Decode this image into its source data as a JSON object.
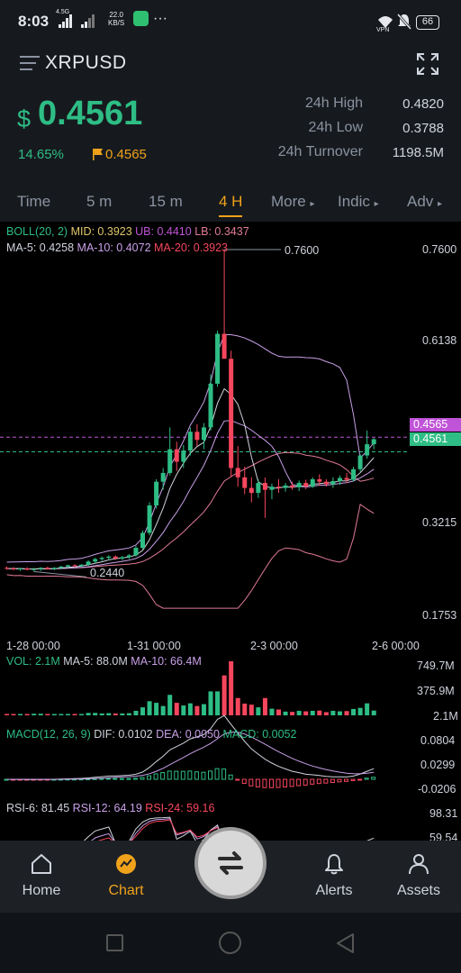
{
  "status_bar": {
    "time": "8:03",
    "network": "4.5G",
    "speed_value": "22.0",
    "speed_unit": "KB/S",
    "more": "···",
    "vpn": "VPN",
    "battery": "66"
  },
  "header": {
    "symbol": "XRPUSD",
    "menu_icon": "menu-icon",
    "fullscreen_icon": "fullscreen-icon"
  },
  "ticker": {
    "currency": "$",
    "price": "0.4561",
    "change_pct": "14.65%",
    "flag_price": "0.4565",
    "stats": [
      {
        "label": "24h High",
        "value": "0.4820"
      },
      {
        "label": "24h Low",
        "value": "0.3788"
      },
      {
        "label": "24h Turnover",
        "value": "1198.5M"
      }
    ]
  },
  "timeframes": [
    {
      "label": "Time",
      "active": false
    },
    {
      "label": "5 m",
      "active": false
    },
    {
      "label": "15 m",
      "active": false
    },
    {
      "label": "4 H",
      "active": true
    },
    {
      "label": "More",
      "active": false
    },
    {
      "label": "Indic",
      "active": false
    },
    {
      "label": "Adv",
      "active": false
    }
  ],
  "indicators": {
    "boll": {
      "name": "BOLL(20, 2)",
      "mid": "MID: 0.3923",
      "ub": "UB: 0.4410",
      "lb": "LB: 0.3437"
    },
    "ma": {
      "ma5": "MA-5: 0.4258",
      "ma10": "MA-10: 0.4072",
      "ma20": "MA-20: 0.3923"
    },
    "vol": {
      "vol": "VOL: 2.1M",
      "ma5": "MA-5: 88.0M",
      "ma10": "MA-10: 66.4M"
    },
    "macd": {
      "name": "MACD(12, 26, 9)",
      "dif": "DIF: 0.0102",
      "dea": "DEA: 0.0050",
      "macd": "MACD: 0.0052"
    },
    "rsi": {
      "rsi6": "RSI-6: 81.45",
      "rsi12": "RSI-12: 64.19",
      "rsi24": "RSI-24: 59.16"
    }
  },
  "chart_data": {
    "type": "candlestick",
    "price_axis": [
      "0.7600",
      "0.6138",
      "0.4565",
      "0.4561",
      "0.3215",
      "0.1753"
    ],
    "time_axis": [
      "1-28 00:00",
      "1-31 00:00",
      "2-3 00:00",
      "2-6 00:00"
    ],
    "annotations": {
      "high": "0.7600",
      "low": "0.2440"
    },
    "ylim": [
      0.1753,
      0.76
    ],
    "current_price": 0.4561,
    "flag_price": 0.4565,
    "volume_axis": [
      "749.7M",
      "375.9M",
      "2.1M"
    ],
    "macd_axis": [
      "0.0804",
      "0.0299",
      "-0.0206"
    ],
    "rsi_axis": [
      "98.31",
      "59.54"
    ],
    "candles": [
      [
        0.25,
        0.252,
        0.247,
        0.249
      ],
      [
        0.249,
        0.251,
        0.246,
        0.248
      ],
      [
        0.248,
        0.25,
        0.245,
        0.249
      ],
      [
        0.249,
        0.251,
        0.246,
        0.247
      ],
      [
        0.247,
        0.25,
        0.244,
        0.248
      ],
      [
        0.248,
        0.251,
        0.245,
        0.25
      ],
      [
        0.25,
        0.252,
        0.247,
        0.248
      ],
      [
        0.248,
        0.251,
        0.246,
        0.25
      ],
      [
        0.25,
        0.253,
        0.248,
        0.252
      ],
      [
        0.252,
        0.255,
        0.25,
        0.254
      ],
      [
        0.254,
        0.256,
        0.251,
        0.253
      ],
      [
        0.253,
        0.256,
        0.251,
        0.255
      ],
      [
        0.255,
        0.262,
        0.253,
        0.26
      ],
      [
        0.26,
        0.266,
        0.257,
        0.264
      ],
      [
        0.264,
        0.268,
        0.261,
        0.266
      ],
      [
        0.266,
        0.27,
        0.262,
        0.268
      ],
      [
        0.268,
        0.27,
        0.263,
        0.265
      ],
      [
        0.265,
        0.269,
        0.262,
        0.267
      ],
      [
        0.267,
        0.272,
        0.264,
        0.27
      ],
      [
        0.27,
        0.285,
        0.268,
        0.282
      ],
      [
        0.282,
        0.31,
        0.28,
        0.306
      ],
      [
        0.306,
        0.355,
        0.302,
        0.35
      ],
      [
        0.35,
        0.392,
        0.345,
        0.388
      ],
      [
        0.388,
        0.41,
        0.375,
        0.402
      ],
      [
        0.402,
        0.475,
        0.398,
        0.44
      ],
      [
        0.44,
        0.452,
        0.405,
        0.42
      ],
      [
        0.42,
        0.447,
        0.41,
        0.438
      ],
      [
        0.438,
        0.475,
        0.43,
        0.468
      ],
      [
        0.468,
        0.48,
        0.445,
        0.455
      ],
      [
        0.455,
        0.482,
        0.44,
        0.475
      ],
      [
        0.475,
        0.56,
        0.47,
        0.545
      ],
      [
        0.545,
        0.63,
        0.54,
        0.625
      ],
      [
        0.625,
        0.76,
        0.61,
        0.585
      ],
      [
        0.585,
        0.598,
        0.395,
        0.41
      ],
      [
        0.41,
        0.445,
        0.38,
        0.395
      ],
      [
        0.395,
        0.412,
        0.368,
        0.378
      ],
      [
        0.378,
        0.395,
        0.355,
        0.37
      ],
      [
        0.37,
        0.392,
        0.362,
        0.386
      ],
      [
        0.386,
        0.395,
        0.33,
        0.375
      ],
      [
        0.375,
        0.385,
        0.36,
        0.38
      ],
      [
        0.38,
        0.392,
        0.37,
        0.378
      ],
      [
        0.378,
        0.386,
        0.372,
        0.382
      ],
      [
        0.382,
        0.388,
        0.375,
        0.379
      ],
      [
        0.379,
        0.39,
        0.373,
        0.386
      ],
      [
        0.386,
        0.391,
        0.376,
        0.38
      ],
      [
        0.38,
        0.395,
        0.378,
        0.392
      ],
      [
        0.392,
        0.4,
        0.382,
        0.388
      ],
      [
        0.388,
        0.392,
        0.38,
        0.384
      ],
      [
        0.384,
        0.395,
        0.378,
        0.389
      ],
      [
        0.389,
        0.398,
        0.383,
        0.394
      ],
      [
        0.394,
        0.402,
        0.386,
        0.391
      ],
      [
        0.391,
        0.412,
        0.388,
        0.408
      ],
      [
        0.408,
        0.432,
        0.404,
        0.43
      ],
      [
        0.43,
        0.47,
        0.425,
        0.448
      ],
      [
        0.448,
        0.458,
        0.44,
        0.4561
      ]
    ]
  },
  "bottom_nav": [
    {
      "label": "Home",
      "icon": "home-icon",
      "active": false
    },
    {
      "label": "Chart",
      "icon": "chart-icon",
      "active": true
    },
    {
      "label": "Alerts",
      "icon": "bell-icon",
      "active": false
    },
    {
      "label": "Assets",
      "icon": "person-icon",
      "active": false
    }
  ],
  "center_button_icon": "swap-arrows-icon",
  "system_nav": [
    "square-icon",
    "circle-icon",
    "back-triangle-icon"
  ],
  "colors": {
    "up": "#2ebd85",
    "down": "#f6465d",
    "accent": "#f0a21b",
    "purple": "#c054d8",
    "background": "#161a1e"
  }
}
